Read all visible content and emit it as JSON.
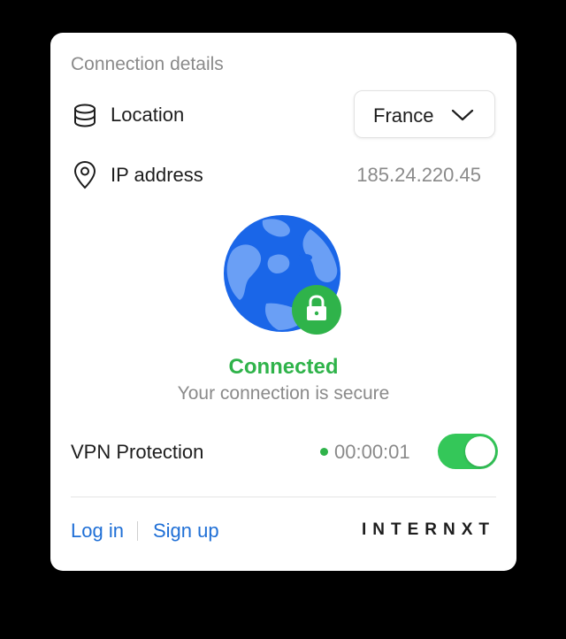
{
  "card": {
    "section_title": "Connection details",
    "location": {
      "label": "Location",
      "icon": "database-icon",
      "selected_country": "France"
    },
    "ip": {
      "label": "IP address",
      "icon": "map-pin-icon",
      "value": "185.24.220.45"
    },
    "status": {
      "title": "Connected",
      "subtitle": "Your connection is secure",
      "color": "#2fb34a"
    },
    "vpn": {
      "label": "VPN Protection",
      "timer": "00:00:01",
      "enabled": true
    },
    "footer": {
      "login_label": "Log in",
      "signup_label": "Sign up",
      "brand": "INTERNXT"
    }
  },
  "colors": {
    "link": "#1f6fd6",
    "toggle_on": "#34c759",
    "globe_dark": "#1a66e8",
    "globe_light": "#6a9ff5"
  }
}
